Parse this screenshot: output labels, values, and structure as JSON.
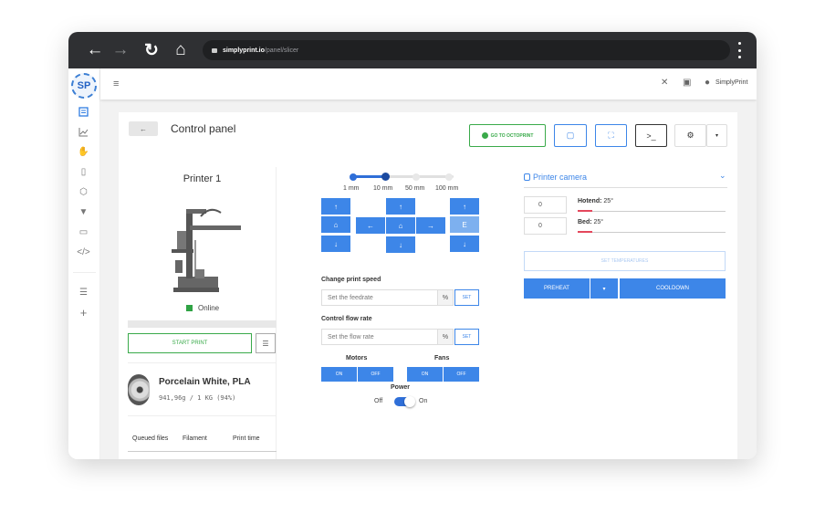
{
  "browser": {
    "url_host": "simplyprint.io",
    "url_path": "/panel/slicer"
  },
  "sidebar": {
    "logo": "SP",
    "items": [
      {
        "icon": "dashboard-icon"
      },
      {
        "icon": "chart-icon"
      },
      {
        "icon": "hand-icon"
      },
      {
        "icon": "files-icon"
      },
      {
        "icon": "cube-icon"
      },
      {
        "icon": "filament-icon"
      },
      {
        "icon": "folder-icon"
      },
      {
        "icon": "code-icon"
      },
      {
        "icon": "sliders-icon"
      },
      {
        "icon": "plus-icon"
      }
    ]
  },
  "topbar": {
    "username": "SimplyPrint"
  },
  "header": {
    "title": "Control panel",
    "back": "←",
    "octoprint": "GO TO OCTOPRINT",
    "terminal": ">_"
  },
  "printer": {
    "name": "Printer 1",
    "status": "Online",
    "start_print": "START PRINT"
  },
  "filament": {
    "name": "Porcelain White, PLA",
    "amount": "941,96g / 1 KG (94%)"
  },
  "queue": {
    "headers": [
      "Queued files",
      "Filament",
      "Print time"
    ]
  },
  "movement": {
    "steps": [
      "1 mm",
      "10 mm",
      "50 mm",
      "100 mm"
    ],
    "selected_step": "10 mm",
    "up": "↑",
    "down": "↓",
    "left": "←",
    "right": "→",
    "home": "⌂",
    "e": "E"
  },
  "speed": {
    "label": "Change print speed",
    "placeholder": "Set the feedrate",
    "unit": "%",
    "set": "SET"
  },
  "flow": {
    "label": "Control flow rate",
    "placeholder": "Set the flow rate",
    "unit": "%",
    "set": "SET"
  },
  "motors": {
    "label": "Motors",
    "on": "ON",
    "off": "OFF"
  },
  "fans": {
    "label": "Fans",
    "on": "ON",
    "off": "OFF"
  },
  "power": {
    "label": "Power",
    "off": "Off",
    "on": "On",
    "state": true
  },
  "camera": {
    "label": "Printer camera"
  },
  "temps": {
    "hotend": {
      "label": "Hotend:",
      "value": "25°",
      "input": "0"
    },
    "bed": {
      "label": "Bed:",
      "value": "25°",
      "input": "0"
    },
    "set": "SET TEMPERATURES",
    "preheat": "PREHEAT",
    "cooldown": "COOLDOWN"
  },
  "colors": {
    "primary": "#3d86e8",
    "success": "#3aaa4a",
    "danger": "#e4475c"
  }
}
